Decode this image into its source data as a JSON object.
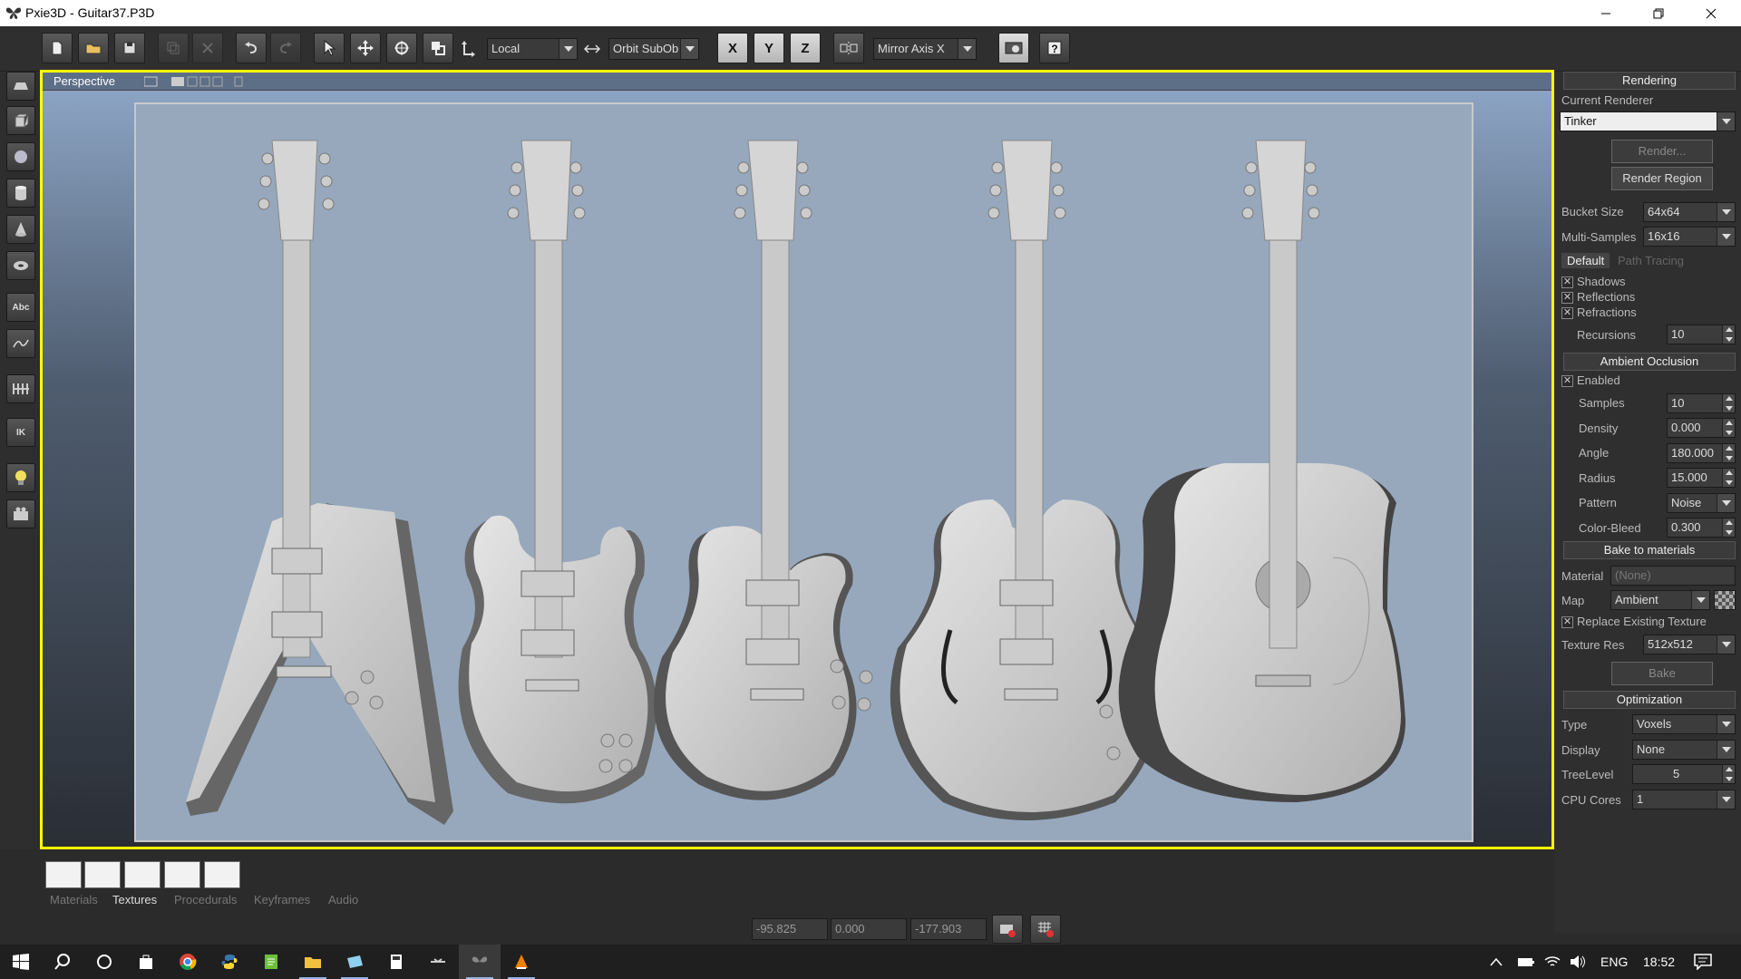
{
  "window": {
    "title": "Pxie3D - Guitar37.P3D"
  },
  "toolbar": {
    "coord_space": "Local",
    "orbit_mode": "Orbit SubOb",
    "axis_x": "X",
    "axis_y": "Y",
    "axis_z": "Z",
    "mirror_axis": "Mirror Axis X"
  },
  "left_tools": {
    "text_tool": "Abc",
    "ik_tool": "IK"
  },
  "viewport": {
    "label": "Perspective"
  },
  "rendering": {
    "header": "Rendering",
    "current_renderer_label": "Current Renderer",
    "current_renderer": "Tinker",
    "render_button": "Render...",
    "render_region_button": "Render Region",
    "bucket_size_label": "Bucket Size",
    "bucket_size": "64x64",
    "multi_samples_label": "Multi-Samples",
    "multi_samples": "16x16",
    "tab_default": "Default",
    "tab_path_tracing": "Path Tracing",
    "shadows": "Shadows",
    "reflections": "Reflections",
    "refractions": "Refractions",
    "recursions_label": "Recursions",
    "recursions": "10"
  },
  "ambient_occlusion": {
    "header": "Ambient Occlusion",
    "enabled": "Enabled",
    "samples_label": "Samples",
    "samples": "10",
    "density_label": "Density",
    "density": "0.000",
    "angle_label": "Angle",
    "angle": "180.000",
    "radius_label": "Radius",
    "radius": "15.000",
    "pattern_label": "Pattern",
    "pattern": "Noise",
    "color_bleed_label": "Color-Bleed",
    "color_bleed": "0.300"
  },
  "bake": {
    "header": "Bake to materials",
    "material_label": "Material",
    "material_placeholder": "(None)",
    "map_label": "Map",
    "map": "Ambient",
    "replace_texture": "Replace Existing Texture",
    "texture_res_label": "Texture Res",
    "texture_res": "512x512",
    "bake_button": "Bake"
  },
  "optimization": {
    "header": "Optimization",
    "type_label": "Type",
    "type": "Voxels",
    "display_label": "Display",
    "display": "None",
    "tree_level_label": "TreeLevel",
    "tree_level": "5",
    "cpu_cores_label": "CPU Cores",
    "cpu_cores": "1"
  },
  "bottom": {
    "tabs": [
      "Materials",
      "Textures",
      "Procedurals",
      "Keyframes",
      "Audio"
    ],
    "coord_x": "-95.825",
    "coord_y": "0.000",
    "coord_z": "-177.903"
  },
  "taskbar": {
    "language": "ENG",
    "time": "18:52"
  },
  "colors": {
    "viewport_border": "#ffff00",
    "viewport_bg": "#97a8bd",
    "panel_bg": "#2f2f2f"
  }
}
